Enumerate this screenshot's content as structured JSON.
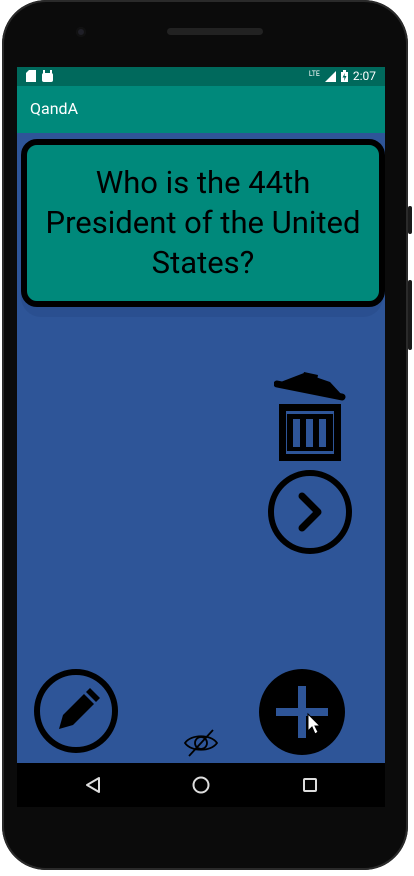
{
  "status_bar": {
    "network": "LTE",
    "time": "2:07",
    "left_icons": [
      "sd-card-icon",
      "android-icon"
    ],
    "right_icons": [
      "signal-icon",
      "battery-icon"
    ]
  },
  "app_bar": {
    "title": "QandA"
  },
  "card": {
    "question": "Who is the 44th President of the United States?"
  },
  "actions": {
    "delete": "trash-icon",
    "next": "chevron-right-circle-icon",
    "edit": "pencil-circle-icon",
    "add": "plus-circle-icon",
    "toggle_answer": "eye-off-icon"
  },
  "nav": {
    "back": "back-triangle-icon",
    "home": "home-circle-icon",
    "recents": "recents-square-icon"
  },
  "colors": {
    "status_bar": "#00695c",
    "app_bar": "#00897b",
    "background": "#2e5598",
    "card": "#00897b"
  }
}
